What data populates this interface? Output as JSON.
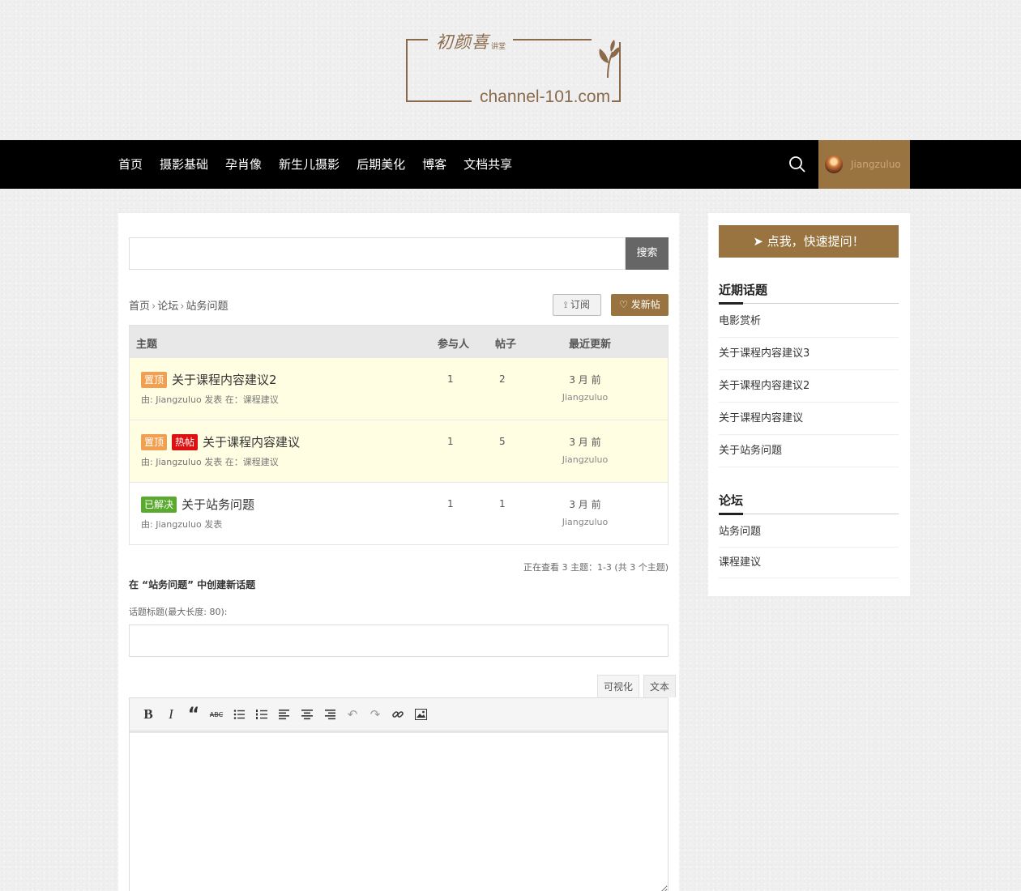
{
  "logo": {
    "cn": "初颜喜",
    "cn_small": "讲堂",
    "en": "channel-101.com"
  },
  "nav": {
    "items": [
      "首页",
      "摄影基础",
      "孕肖像",
      "新生儿摄影",
      "后期美化",
      "博客",
      "文档共享"
    ],
    "username": "Jiangzuluo",
    "search_icon": "search-icon"
  },
  "search": {
    "button": "搜索",
    "placeholder": ""
  },
  "breadcrumb": [
    "首页",
    "论坛",
    "站务问题"
  ],
  "buttons": {
    "subscribe": "订阅",
    "new_topic": "发新帖"
  },
  "table": {
    "headers": {
      "topic": "主题",
      "voices": "参与人",
      "posts": "帖子",
      "updated": "最近更新"
    },
    "rows": [
      {
        "tags": [
          "置顶"
        ],
        "title": "关于课程内容建议2",
        "meta": "由: Jiangzuluo 发表 在：课程建议",
        "voices": "1",
        "posts": "2",
        "time": "3 月 前",
        "user": "Jiangzuluo",
        "highlight": true
      },
      {
        "tags": [
          "置顶",
          "热帖"
        ],
        "title": "关于课程内容建议",
        "meta": "由: Jiangzuluo 发表 在：课程建议",
        "voices": "1",
        "posts": "5",
        "time": "3 月 前",
        "user": "Jiangzuluo",
        "highlight": true
      },
      {
        "tags": [
          "已解决"
        ],
        "title": "关于站务问题",
        "meta": "由: Jiangzuluo 发表",
        "voices": "1",
        "posts": "1",
        "time": "3 月 前",
        "user": "Jiangzuluo",
        "highlight": false
      }
    ]
  },
  "pagination_text": "正在查看 3 主题：1-3 (共 3 个主题)",
  "form": {
    "title": "在 “站务问题” 中创建新话题",
    "label": "话题标题(最大长度: 80):",
    "tab_visual": "可视化",
    "tab_text": "文本"
  },
  "sidebar": {
    "ask_button": "点我，快速提问！",
    "recent_heading": "近期话题",
    "recent": [
      "电影赏析",
      "关于课程内容建议3",
      "关于课程内容建议2",
      "关于课程内容建议",
      "关于站务问题"
    ],
    "forum_heading": "论坛",
    "forums": [
      "站务问题",
      "课程建议"
    ]
  },
  "colors": {
    "brand": "#9a7440",
    "nav_bg": "#000000",
    "sticky_bg": "#fffde2",
    "hot": "#dd1111",
    "solved": "#5aaa30",
    "pin": "#f0a050"
  }
}
